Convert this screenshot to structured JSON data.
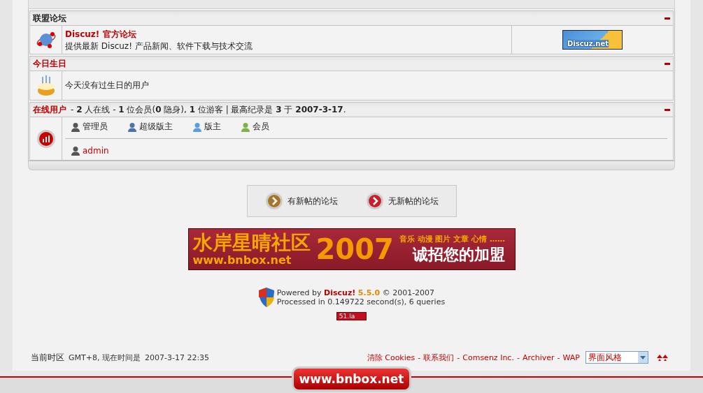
{
  "partner_forums": {
    "title": "联盟论坛",
    "forums": [
      {
        "name": "Discuz! 官方论坛",
        "description": "提供最新 Discuz! 产品新闻、软件下载与技术交流",
        "logo_text": "Discuz.net"
      }
    ]
  },
  "birthdays": {
    "title": "今日生日",
    "message": "今天没有过生日的用户"
  },
  "online": {
    "title": "在线用户",
    "summary": "- **2** 人在线 - **1** 位会员(**0** 隐身), **1** 位游客 | 最高纪录是 **3** 于 **2007-3-17**.",
    "legend": [
      {
        "label": "管理员",
        "color": "#555555"
      },
      {
        "label": "超级版主",
        "color": "#4a74a8"
      },
      {
        "label": "版主",
        "color": "#5b9de0"
      },
      {
        "label": "会员",
        "color": "#7cb342"
      }
    ],
    "users": [
      {
        "name": "admin",
        "color": "#555555"
      }
    ]
  },
  "forum_key": [
    {
      "label": "有新帖的论坛",
      "kind": "new"
    },
    {
      "label": "无新帖的论坛",
      "kind": "none"
    }
  ],
  "banner": {
    "title": "水岸星晴社区",
    "url": "www.bnbox.net",
    "year": "2007",
    "tagline": "音乐 动漫 图片 文章 心情 ……",
    "slogan": "诚招您的加盟"
  },
  "powered": {
    "prefix": "Powered by",
    "brand": "Discuz!",
    "version": "5.5.0",
    "copyright": "© 2001-2007",
    "processed": "Processed in 0.149722 second(s), 6 queries",
    "counter": "51.la"
  },
  "footer": {
    "timezone_label": "当前时区",
    "timezone": "GMT+8, 现在时间是",
    "time": "2007-3-17 22:35",
    "links": [
      {
        "label": "清除 Cookies"
      },
      {
        "label": "联系我们",
        "separator": "-"
      },
      {
        "label": "Comsenz Inc.",
        "separator": "-"
      },
      {
        "label": "Archiver",
        "separator": "-"
      },
      {
        "label": "WAP",
        "separator": "-"
      }
    ],
    "style_select": "界面风格"
  },
  "bottom_bar": {
    "site_button": "www.bnbox.net"
  }
}
